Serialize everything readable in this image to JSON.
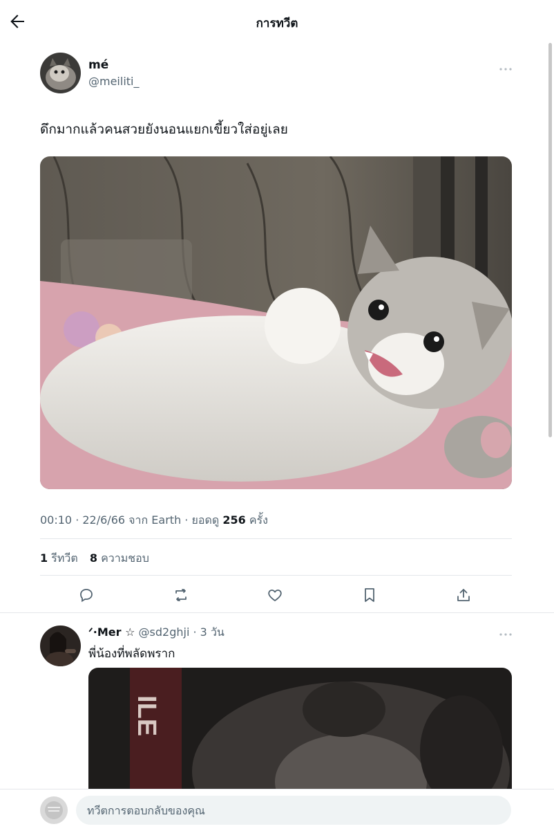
{
  "header": {
    "title": "การทวีต"
  },
  "tweet": {
    "name": "mé",
    "handle": "@meiliti_",
    "text": "ดึกมากแล้วคนสวยยังนอนแยกเขี้ยวใส่อยู่เลย",
    "time": "00:10",
    "date": "22/6/66",
    "source_prefix": "จาก",
    "source": "Earth",
    "views_label": "ยอดดู",
    "views": "256",
    "views_unit": "ครั้ง",
    "retweets": "1",
    "retweets_label": "รีทวีต",
    "likes": "8",
    "likes_label": "ความชอบ"
  },
  "reply": {
    "name": "ᐟ·Mer ☆",
    "handle": "@sd2ghji",
    "time": "3 วัน",
    "text": "พี่น้องที่พลัดพราก",
    "media_text": "ILE"
  },
  "composer": {
    "placeholder": "ทวีตการตอบกลับของคุณ"
  },
  "icons": [
    "back-arrow-icon",
    "more-icon",
    "reply-icon",
    "retweet-icon",
    "like-icon",
    "bookmark-icon",
    "share-icon"
  ]
}
